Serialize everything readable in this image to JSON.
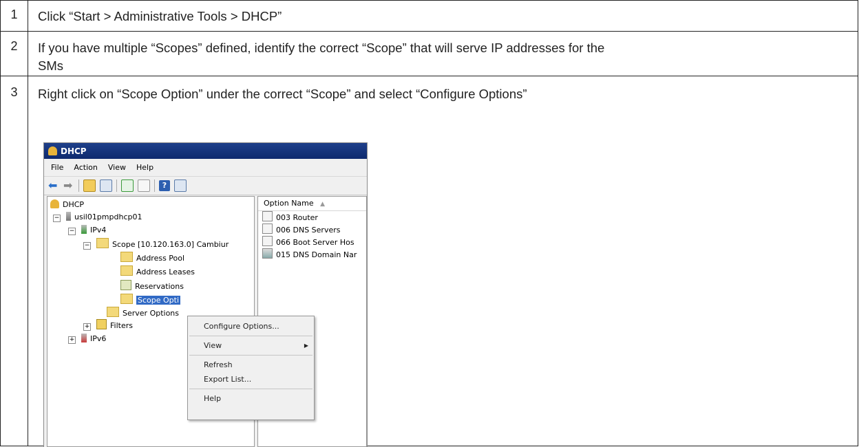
{
  "steps": [
    {
      "num": "1",
      "text": "Click “Start > Administrative Tools > DHCP”"
    },
    {
      "num": "2",
      "text_line1": "If you have multiple “Scopes” defined, identify the correct “Scope” that will serve IP addresses for the",
      "text_line2": "SMs"
    },
    {
      "num": "3",
      "text": "Right click on “Scope Option” under the correct “Scope” and select “Configure Options”"
    }
  ],
  "window": {
    "title": "DHCP",
    "menu": [
      "File",
      "Action",
      "View",
      "Help"
    ],
    "tree": {
      "root": "DHCP",
      "server": "usil01pmpdhcp01",
      "ipv4": "IPv4",
      "scope": "Scope [10.120.163.0] Cambiur",
      "address_pool": "Address Pool",
      "address_leases": "Address Leases",
      "reservations": "Reservations",
      "scope_options": "Scope Opti",
      "server_options": "Server Options",
      "filters": "Filters",
      "ipv6": "IPv6"
    },
    "list": {
      "column": "Option Name",
      "rows": [
        "003 Router",
        "006 DNS Servers",
        "066 Boot Server Hos",
        "015 DNS Domain Nar"
      ]
    }
  },
  "context_menu": {
    "items": [
      "Configure Options...",
      "View",
      "Refresh",
      "Export List...",
      "Help"
    ]
  },
  "colors": {
    "titlebar": "#0e2a6e",
    "selection": "#316ac5"
  }
}
